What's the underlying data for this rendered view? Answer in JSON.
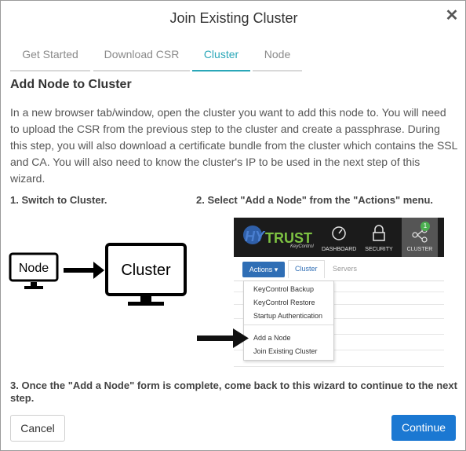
{
  "dialog": {
    "title": "Join Existing Cluster",
    "close_glyph": "✕"
  },
  "tabs": [
    {
      "label": "Get Started",
      "active": false
    },
    {
      "label": "Download CSR",
      "active": false
    },
    {
      "label": "Cluster",
      "active": true
    },
    {
      "label": "Node",
      "active": false
    }
  ],
  "section": {
    "heading": "Add Node to Cluster",
    "paragraph": "In a new browser tab/window, open the cluster you want to add this node to. You will need to upload the CSR from the previous step to the cluster and create a passphrase. During this step, you will also download a certificate bundle from the cluster which contains the SSL and CA. You will also need to know the cluster's IP to be used in the next step of this wizard."
  },
  "steps": {
    "step1": "1. Switch to Cluster.",
    "step2": "2. Select \"Add a Node\" from the \"Actions\" menu.",
    "step3": "3. Once the \"Add a Node\" form is complete, come back to this wizard to continue to the next step."
  },
  "illustration": {
    "node_label": "Node",
    "cluster_label": "Cluster"
  },
  "screenshot": {
    "logo_hy": "HY",
    "logo_trust": "TRUST",
    "logo_sub": "KeyControl",
    "nav": [
      {
        "label": "DASHBOARD",
        "icon": "gauge-icon"
      },
      {
        "label": "SECURITY",
        "icon": "lock-icon"
      },
      {
        "label": "CLUSTER",
        "icon": "cluster-icon",
        "badge": "1"
      }
    ],
    "actions_label": "Actions ▾",
    "tabs": [
      "Cluster",
      "Servers"
    ],
    "menu_items": [
      "KeyControl Backup",
      "KeyControl Restore",
      "Startup Authentication",
      "Add a Node",
      "Join Existing Cluster"
    ]
  },
  "footer": {
    "cancel_label": "Cancel",
    "continue_label": "Continue"
  },
  "colors": {
    "accent": "#2aa7b8",
    "primary": "#1b78d2",
    "text": "#555555"
  }
}
